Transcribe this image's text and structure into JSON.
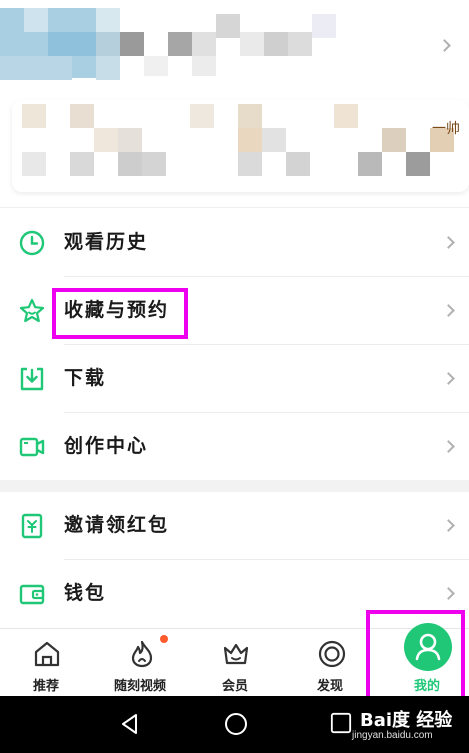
{
  "profile": {
    "banner_note": "一帅"
  },
  "menu": {
    "group1": [
      {
        "label": "观看历史",
        "icon": "clock-icon"
      },
      {
        "label": "收藏与预约",
        "icon": "star-icon"
      },
      {
        "label": "下载",
        "icon": "download-icon"
      },
      {
        "label": "创作中心",
        "icon": "video-camera-icon"
      }
    ],
    "group2": [
      {
        "label": "邀请领红包",
        "icon": "red-envelope-icon"
      },
      {
        "label": "钱包",
        "icon": "wallet-icon"
      }
    ]
  },
  "tabs": [
    {
      "label": "推荐",
      "icon": "home-icon"
    },
    {
      "label": "随刻视频",
      "icon": "flame-icon"
    },
    {
      "label": "会员",
      "icon": "crown-icon"
    },
    {
      "label": "发现",
      "icon": "discover-icon"
    },
    {
      "label": "我的",
      "icon": "user-icon",
      "active": true
    }
  ],
  "watermark": {
    "brand": "Bai度 经验",
    "url": "jingyan.baidu.com"
  },
  "colors": {
    "accent": "#1fc777",
    "icon_green": "#1fc777",
    "highlight": "#ee00ee",
    "badge_dot": "#ff5a2c",
    "nav_bar": "#000000"
  }
}
